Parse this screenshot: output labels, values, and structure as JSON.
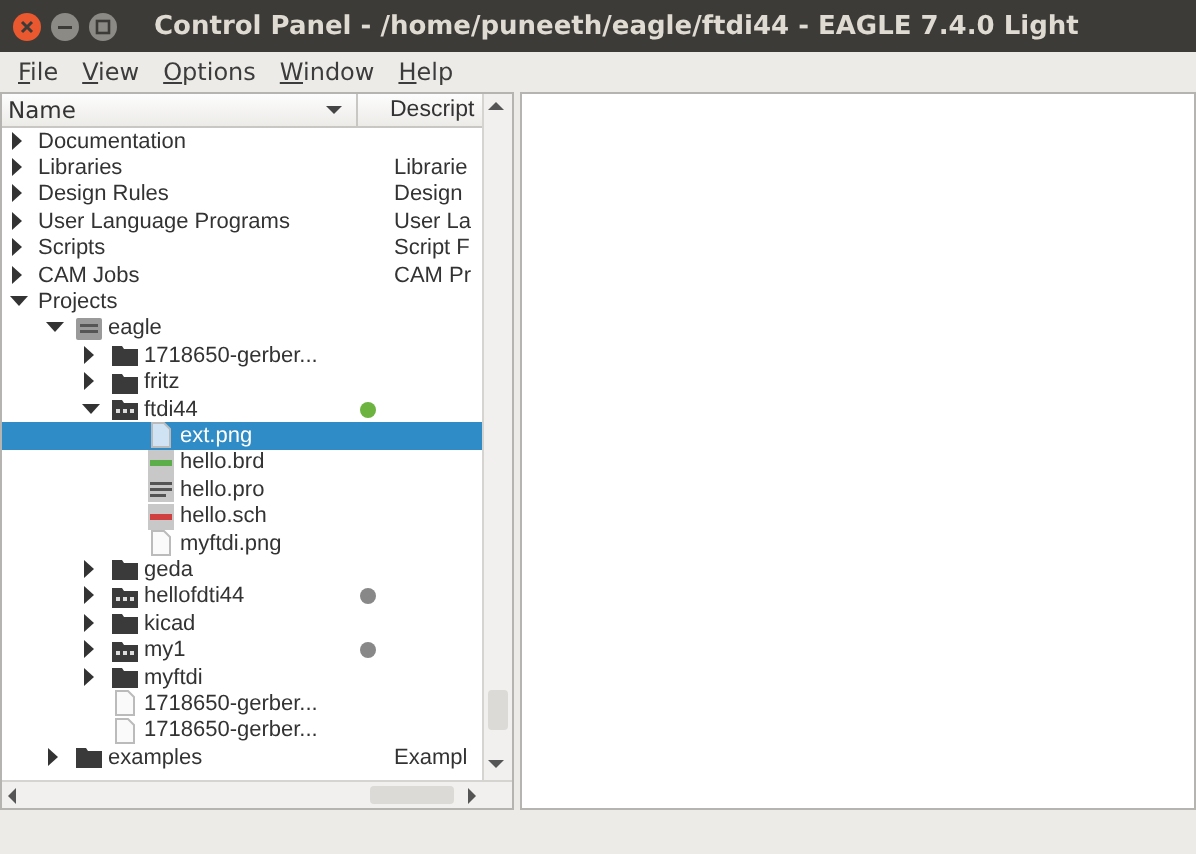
{
  "window": {
    "title": "Control Panel - /home/puneeth/eagle/ftdi44 - EAGLE 7.4.0 Light"
  },
  "menu": [
    "File",
    "View",
    "Options",
    "Window",
    "Help"
  ],
  "tree": {
    "columns": [
      "Name",
      "Descript"
    ],
    "items": [
      {
        "name": "Documentation",
        "expanded": false,
        "selected": false
      },
      {
        "name": "Libraries",
        "expanded": false,
        "selected": false,
        "description": "Librarie"
      },
      {
        "name": "Design Rules",
        "expanded": false,
        "selected": false,
        "description": "Design"
      },
      {
        "name": "User Language Programs",
        "expanded": false,
        "selected": false,
        "description": "User La"
      },
      {
        "name": "Scripts",
        "expanded": false,
        "selected": false,
        "description": "Script F"
      },
      {
        "name": "CAM Jobs",
        "expanded": false,
        "selected": false,
        "description": "CAM Pr"
      },
      {
        "name": "Projects",
        "expanded": true,
        "selected": false,
        "children": [
          {
            "name": "eagle",
            "kind": "root",
            "expanded": true,
            "selected": false,
            "children": [
              {
                "name": "1718650-gerber...",
                "kind": "folder",
                "expanded": false,
                "selected": false
              },
              {
                "name": "fritz",
                "kind": "folder",
                "expanded": false,
                "selected": false
              },
              {
                "name": "ftdi44",
                "kind": "project",
                "expanded": true,
                "selected": false,
                "color": "#6cb33f",
                "children": [
                  {
                    "name": "ext.png",
                    "kind": "file",
                    "selected": true
                  },
                  {
                    "name": "hello.brd",
                    "kind": "board",
                    "selected": false
                  },
                  {
                    "name": "hello.pro",
                    "kind": "text",
                    "selected": false
                  },
                  {
                    "name": "hello.sch",
                    "kind": "schematic",
                    "selected": false
                  },
                  {
                    "name": "myftdi.png",
                    "kind": "file",
                    "selected": false
                  }
                ]
              },
              {
                "name": "geda",
                "kind": "folder",
                "expanded": false,
                "selected": false
              },
              {
                "name": "hellofdti44",
                "kind": "project",
                "expanded": false,
                "selected": false,
                "color": "#888888"
              },
              {
                "name": "kicad",
                "kind": "folder",
                "expanded": false,
                "selected": false
              },
              {
                "name": "my1",
                "kind": "project",
                "expanded": false,
                "selected": false,
                "color": "#888888"
              },
              {
                "name": "myftdi",
                "kind": "folder",
                "expanded": false,
                "selected": false
              },
              {
                "name": "1718650-gerber...",
                "kind": "file",
                "selected": false
              },
              {
                "name": "1718650-gerber...",
                "kind": "file",
                "selected": false
              }
            ]
          },
          {
            "name": "examples",
            "kind": "folder",
            "expanded": false,
            "selected": false,
            "description": "Exampl"
          }
        ]
      }
    ]
  }
}
